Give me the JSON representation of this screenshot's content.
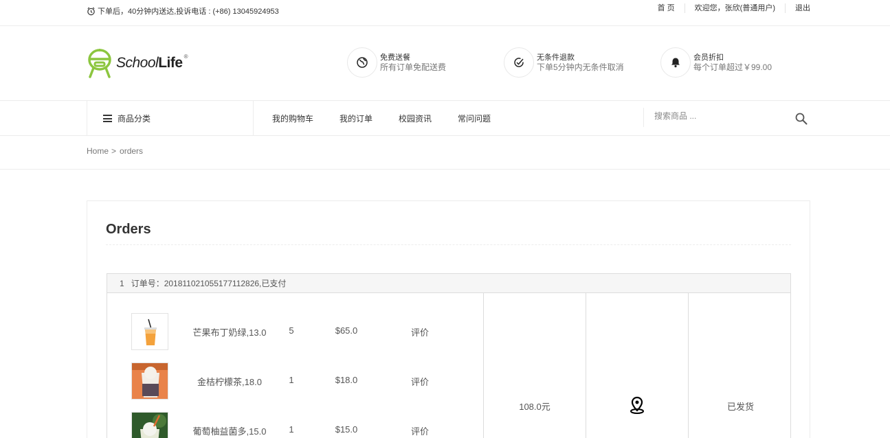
{
  "topbar": {
    "notice": "下单后，40分钟内送达,投诉电话 : (+86) 13045924953",
    "links": [
      "首 页",
      "欢迎您，张欣(普通用户)",
      "退出"
    ]
  },
  "header": {
    "logo_school": "School",
    "logo_life": "Life",
    "logo_reg": "®",
    "features": [
      {
        "icon": "globe-icon",
        "title": "免费送餐",
        "subtitle": "所有订单免配送费"
      },
      {
        "icon": "check-circle-icon",
        "title": "无条件退款",
        "subtitle": "下单5分钟内无条件取消"
      },
      {
        "icon": "bell-icon",
        "title": "会员折扣",
        "subtitle": "每个订单超过￥99.00"
      }
    ]
  },
  "nav": {
    "category_label": "商品分类",
    "menu": [
      "我的购物车",
      "我的订单",
      "校园资讯",
      "常问问题"
    ],
    "search_placeholder": "搜索商品 ..."
  },
  "breadcrumb": {
    "home": "Home",
    "separator": ">",
    "current": "orders"
  },
  "orders": {
    "title": "Orders",
    "list": [
      {
        "index": "1",
        "header": "订单号：20181102105517711282​6,已支付",
        "items": [
          {
            "name": "芒果布丁奶绿,13.0",
            "qty": "5",
            "price": "$65.0",
            "action": "评价",
            "thumb": "iced-drink"
          },
          {
            "name": "金桔柠檬茶,18.0",
            "qty": "1",
            "price": "$18.0",
            "action": "评价",
            "thumb": "milk-tea"
          },
          {
            "name": "葡萄柚益菌多,15.0",
            "qty": "1",
            "price": "$15.0",
            "action": "评价",
            "thumb": "green-drink"
          }
        ],
        "total": "108.0元",
        "location_icon": "map-pin-icon",
        "status": "已发货"
      }
    ]
  },
  "colors": {
    "logo_green": "#8cc63f",
    "border": "#ececec",
    "order_head_bg": "#f6f6f6"
  }
}
